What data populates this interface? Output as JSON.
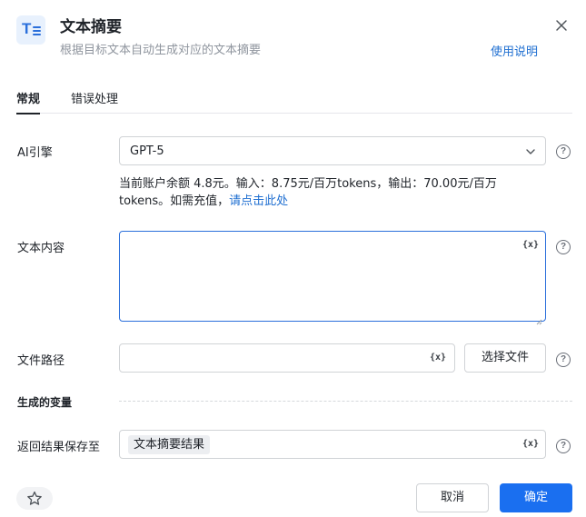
{
  "header": {
    "title": "文本摘要",
    "subtitle": "根据目标文本自动生成对应的文本摘要",
    "help_link": "使用说明",
    "icon": "text-summary-icon"
  },
  "tabs": [
    {
      "label": "常规",
      "active": true
    },
    {
      "label": "错误处理",
      "active": false
    }
  ],
  "form": {
    "ai_engine": {
      "label": "AI引擎",
      "value": "GPT-5",
      "note_line1": "当前账户余额 4.8元。输入：8.75元/百万tokens，输出：70.00元/百万",
      "note_line2": "tokens。如需充值，",
      "note_link": "请点击此处"
    },
    "text_content": {
      "label": "文本内容",
      "value": "",
      "var_icon": "{x}"
    },
    "file_path": {
      "label": "文件路径",
      "value": "",
      "var_icon": "{x}",
      "choose_button": "选择文件"
    },
    "variables_section": "生成的变量",
    "save_to": {
      "label": "返回结果保存至",
      "tag": "文本摘要结果",
      "var_icon": "{x}"
    }
  },
  "footer": {
    "cancel": "取消",
    "confirm": "确定"
  },
  "colors": {
    "accent": "#1a6ff0",
    "link": "#1f6fd1",
    "focus_border": "#2a6fdb"
  }
}
